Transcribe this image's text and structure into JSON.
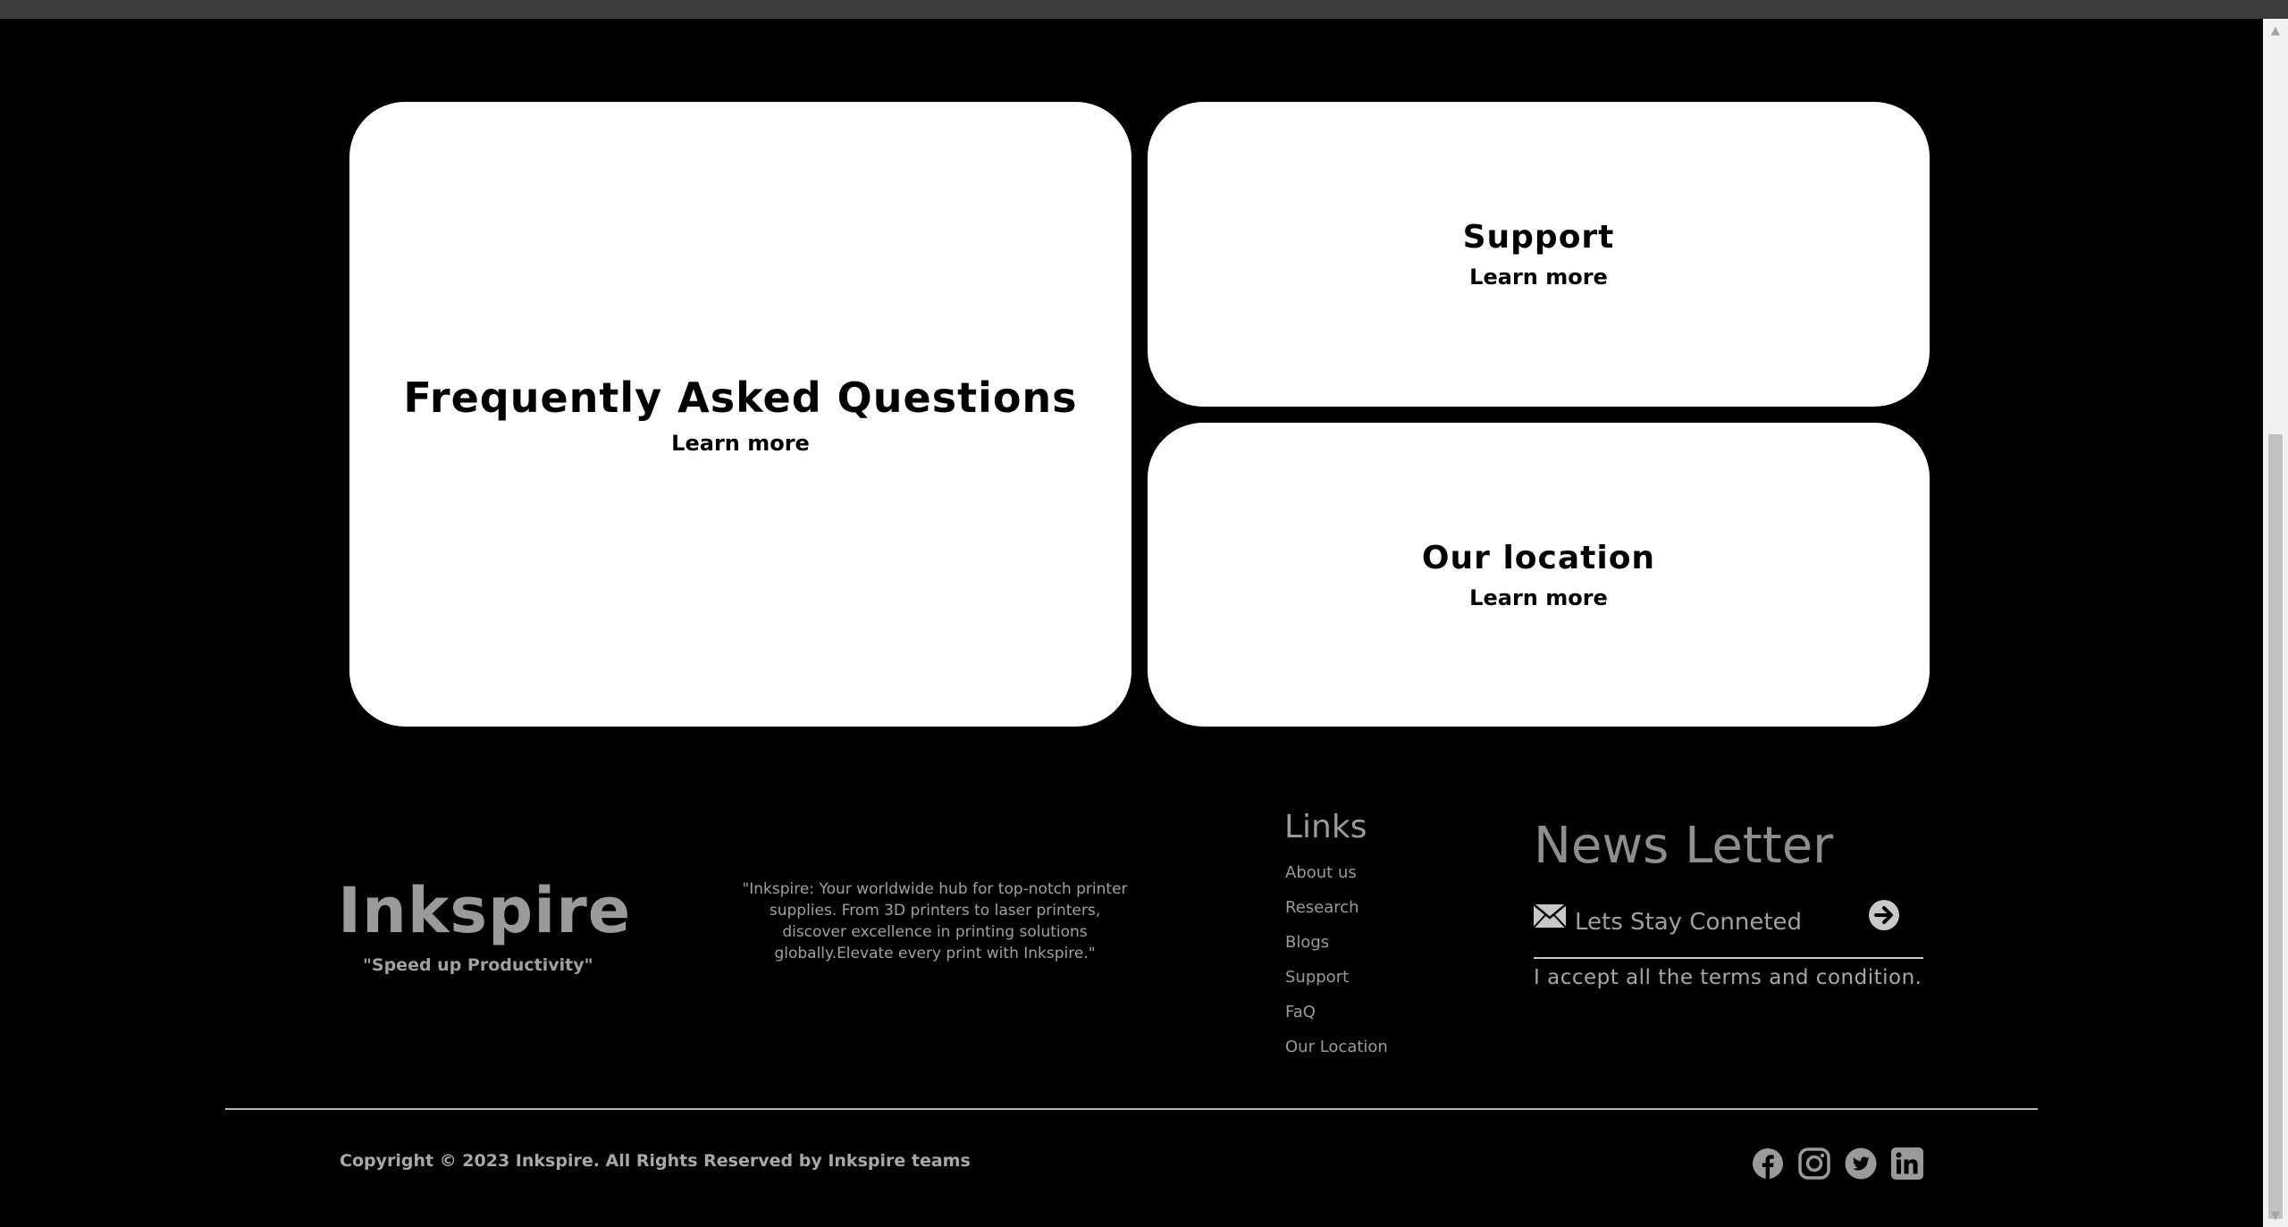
{
  "cards": {
    "faq": {
      "title": "Frequently Asked Questions",
      "link": "Learn more"
    },
    "support": {
      "title": "Support",
      "link": "Learn more"
    },
    "location": {
      "title": "Our location",
      "link": "Learn more"
    }
  },
  "footer": {
    "brand": "Inkspire",
    "tagline": "\"Speed up Productivity\"",
    "about": "\"Inkspire: Your worldwide hub for top-notch printer supplies. From 3D printers to laser printers, discover excellence in printing solutions globally.Elevate every print with Inkspire.\"",
    "links_title": "Links",
    "links": [
      {
        "label": "About us"
      },
      {
        "label": "Research"
      },
      {
        "label": "Blogs"
      },
      {
        "label": "Support"
      },
      {
        "label": "FaQ"
      },
      {
        "label": "Our Location"
      }
    ],
    "newsletter": {
      "title": "News Letter",
      "placeholder": "Lets Stay Conneted",
      "terms": "I accept all the terms and condition.",
      "mail_icon": "envelope-icon",
      "submit_icon": "arrow-right-circle-icon"
    },
    "copyright": "Copyright © 2023 Inkspire. All Rights Reserved by Inkspire teams",
    "social": [
      "facebook-icon",
      "instagram-icon",
      "twitter-icon",
      "linkedin-icon"
    ]
  },
  "colors": {
    "background": "#000000",
    "card": "#ffffff",
    "footer_text": "#9a9a9a",
    "topbar": "#3c3c3c"
  }
}
